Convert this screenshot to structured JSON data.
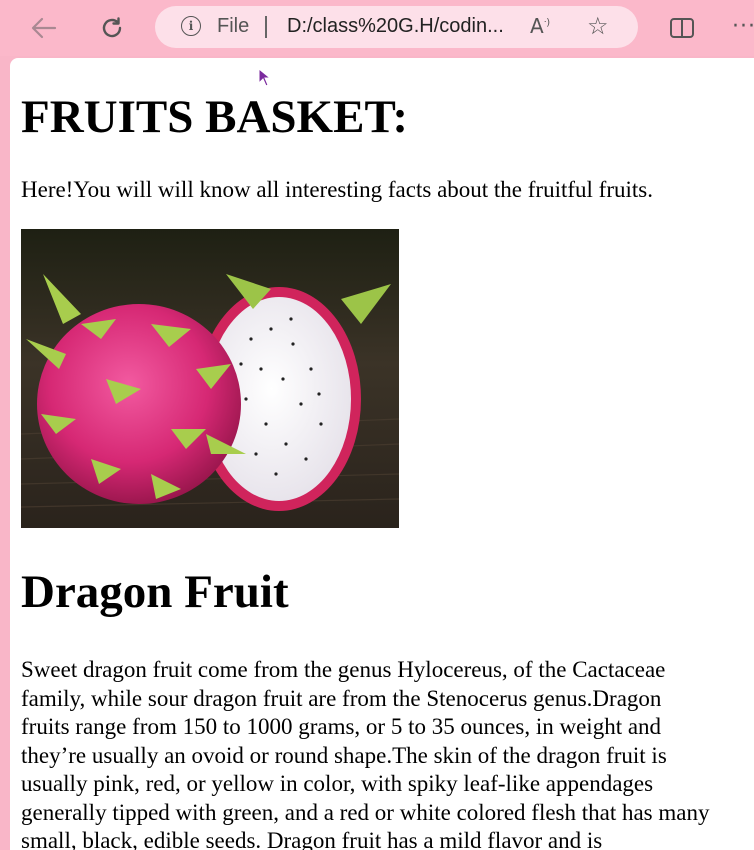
{
  "browser": {
    "addressbar": {
      "scheme_label": "File",
      "url": "D:/class%20G.H/codin..."
    },
    "icons": {
      "back": "back-arrow-icon",
      "refresh": "refresh-icon",
      "info": "info-icon",
      "read_aloud": "read-aloud-icon",
      "favorite": "favorite-star-icon",
      "split_screen": "split-screen-icon",
      "more": "more-icon"
    },
    "colors": {
      "toolbar": "#fbb8ca",
      "addressbar": "#fde0e9"
    }
  },
  "page": {
    "heading": "FRUITS BASKET:",
    "intro": "Here!You will will know all interesting facts about the fruitful fruits.",
    "image": "dragon-fruit-photo",
    "section_title": "Dragon Fruit",
    "section_body": "Sweet dragon fruit come from the genus Hylocereus, of the Cactaceae family, while sour dragon fruit are from the Stenocerus genus.Dragon fruits range from 150 to 1000 grams, or 5 to 35 ounces, in weight and they’re usually an ovoid or round shape.The skin of the dragon fruit is usually pink, red, or yellow in color, with spiky leaf-like appendages generally tipped with green, and a red or white colored flesh that has many small, black, edible seeds. Dragon fruit has a mild flavor and is"
  }
}
